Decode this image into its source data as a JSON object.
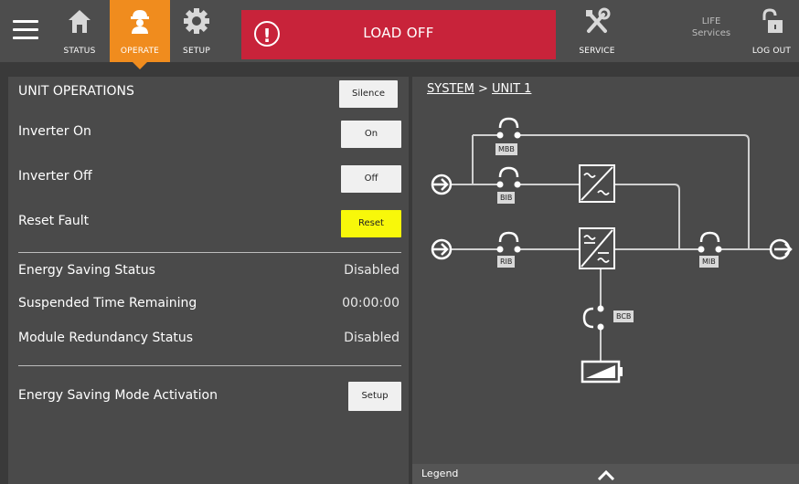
{
  "topbar": {
    "status_label": "STATUS",
    "operate_label": "OPERATE",
    "setup_label": "SETUP",
    "alarm_text": "LOAD OFF",
    "alarm_symbol": "!",
    "service_label": "SERVICE",
    "life_line1": "LIFE",
    "life_line2": "Services",
    "logout_label": "LOG OUT",
    "accent_color": "#f08c1e",
    "alarm_color": "#c8233a"
  },
  "unit_ops": {
    "title": "UNIT OPERATIONS",
    "silence_label": "Silence",
    "inverter_on_label": "Inverter On",
    "inverter_on_button": "On",
    "inverter_off_label": "Inverter Off",
    "inverter_off_button": "Off",
    "reset_fault_label": "Reset Fault",
    "reset_button": "Reset",
    "energy_saving_status_label": "Energy Saving Status",
    "energy_saving_status_value": "Disabled",
    "suspended_time_label": "Suspended Time Remaining",
    "suspended_time_value": "00:00:00",
    "module_redundancy_label": "Module Redundancy Status",
    "module_redundancy_value": "Disabled",
    "activation_label": "Energy Saving Mode Activation",
    "setup_button": "Setup"
  },
  "diagram": {
    "breadcrumb_root": "SYSTEM",
    "breadcrumb_sep": " > ",
    "breadcrumb_current": "UNIT 1",
    "mbb": "MBB",
    "bib": "BIB",
    "rib": "RIB",
    "mib": "MIB",
    "bcb": "BCB",
    "legend_label": "Legend"
  }
}
